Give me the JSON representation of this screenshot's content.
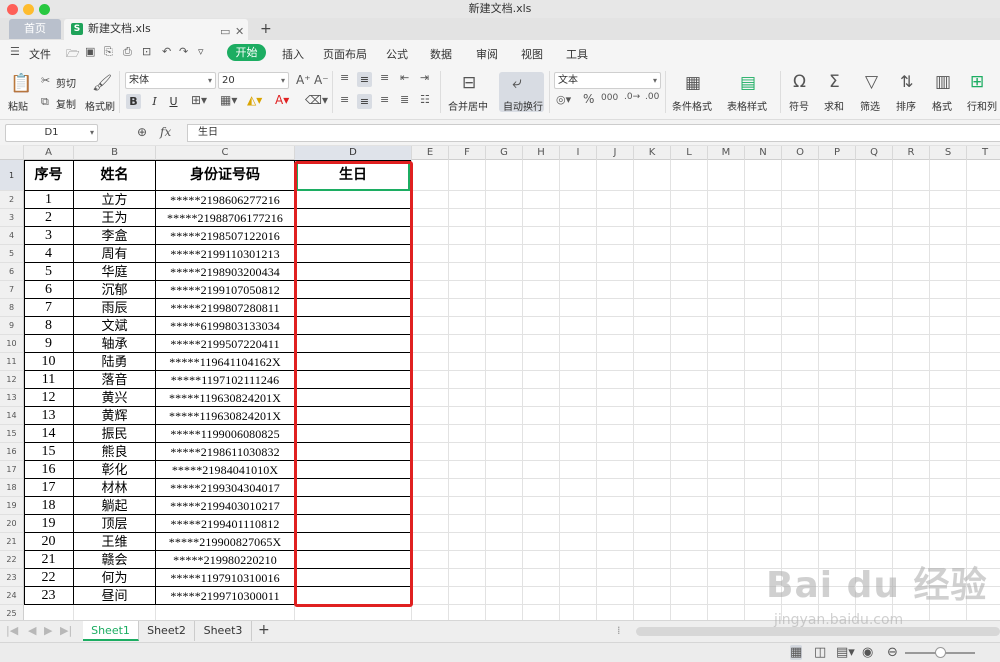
{
  "window": {
    "title": "新建文档.xls"
  },
  "tabs": {
    "home": "首页",
    "doc": "新建文档.xls",
    "add": "+"
  },
  "menu": {
    "file": "文件",
    "start": "开始",
    "items": [
      "插入",
      "页面布局",
      "公式",
      "数据",
      "审阅",
      "视图",
      "工具"
    ]
  },
  "ribbon": {
    "paste": "粘贴",
    "cut": "剪切",
    "copy": "复制",
    "format_painter": "格式刷",
    "font_name": "宋体",
    "font_size": "20",
    "bold": "B",
    "italic": "I",
    "underline": "U",
    "merge_center": "合并居中",
    "wrap_text": "自动换行",
    "number_format": "文本",
    "conditional_format": "条件格式",
    "table_style": "表格样式",
    "symbol": "符号",
    "sum": "求和",
    "filter": "筛选",
    "sort": "排序",
    "format": "格式",
    "rows_cols": "行和列"
  },
  "formula_bar": {
    "name_box": "D1",
    "fx": "fx",
    "content": "生日"
  },
  "sheet": {
    "columns": [
      "A",
      "B",
      "C",
      "D",
      "E",
      "F",
      "G",
      "H",
      "I",
      "J",
      "K",
      "L",
      "M",
      "N",
      "O",
      "P",
      "Q",
      "R",
      "S",
      "T"
    ],
    "row_numbers": [
      "1",
      "2",
      "3",
      "4",
      "5",
      "6",
      "7",
      "8",
      "9",
      "10",
      "11",
      "12",
      "13",
      "14",
      "15",
      "16",
      "17",
      "18",
      "19",
      "20",
      "21",
      "22",
      "23",
      "24",
      "25"
    ],
    "headers": [
      "序号",
      "姓名",
      "身份证号码",
      "生日"
    ],
    "rows": [
      [
        "1",
        "立方",
        "*****2198606277216"
      ],
      [
        "2",
        "王为",
        "*****21988706177216"
      ],
      [
        "3",
        "李盒",
        "*****2198507122016"
      ],
      [
        "4",
        "周有",
        "*****2199110301213"
      ],
      [
        "5",
        "华庭",
        "*****2198903200434"
      ],
      [
        "6",
        "沉郁",
        "*****2199107050812"
      ],
      [
        "7",
        "雨辰",
        "*****2199807280811"
      ],
      [
        "8",
        "文斌",
        "*****6199803133034"
      ],
      [
        "9",
        "轴承",
        "*****2199507220411"
      ],
      [
        "10",
        "陆勇",
        "*****119641104162X"
      ],
      [
        "11",
        "落音",
        "*****1197102111246"
      ],
      [
        "12",
        "黄兴",
        "*****119630824201X"
      ],
      [
        "13",
        "黄辉",
        "*****119630824201X"
      ],
      [
        "14",
        "振民",
        "*****1199006080825"
      ],
      [
        "15",
        "熊良",
        "*****2198611030832"
      ],
      [
        "16",
        "彰化",
        "*****21984041010X"
      ],
      [
        "17",
        "材林",
        "*****2199304304017"
      ],
      [
        "18",
        "躺起",
        "*****2199403010217"
      ],
      [
        "19",
        "顶层",
        "*****2199401110812"
      ],
      [
        "20",
        "王维",
        "*****219900827065X"
      ],
      [
        "21",
        "赣会",
        "*****219980220210"
      ],
      [
        "22",
        "何为",
        "*****1197910310016"
      ],
      [
        "23",
        "昼间",
        "*****2199710300011"
      ]
    ]
  },
  "sheet_tabs": [
    "Sheet1",
    "Sheet2",
    "Sheet3"
  ],
  "watermark": {
    "big": "Bai du 经验",
    "small": "jingyan.baidu.com"
  }
}
